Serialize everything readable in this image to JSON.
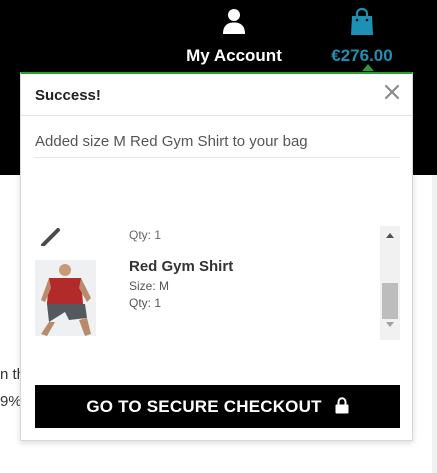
{
  "header": {
    "account_label": "My Account",
    "account_icon": "user-icon",
    "bag_total": "€276.00",
    "bag_icon": "shopping-bag-icon",
    "accent_color": "#1e90b3",
    "background_color": "#000000"
  },
  "background": {
    "text_fragment_1": "n th",
    "text_fragment_2": "9%"
  },
  "popup": {
    "title": "Success!",
    "close_icon": "close-icon",
    "message": "Added size M Red Gym Shirt to your bag",
    "border_color": "#2e9b3a",
    "previous_item": {
      "qty": "Qty: 1"
    },
    "item": {
      "name": "Red Gym Shirt",
      "size": "Size: M",
      "qty": "Qty: 1"
    },
    "checkout_label": "GO TO SECURE CHECKOUT",
    "checkout_icon": "lock-icon"
  }
}
